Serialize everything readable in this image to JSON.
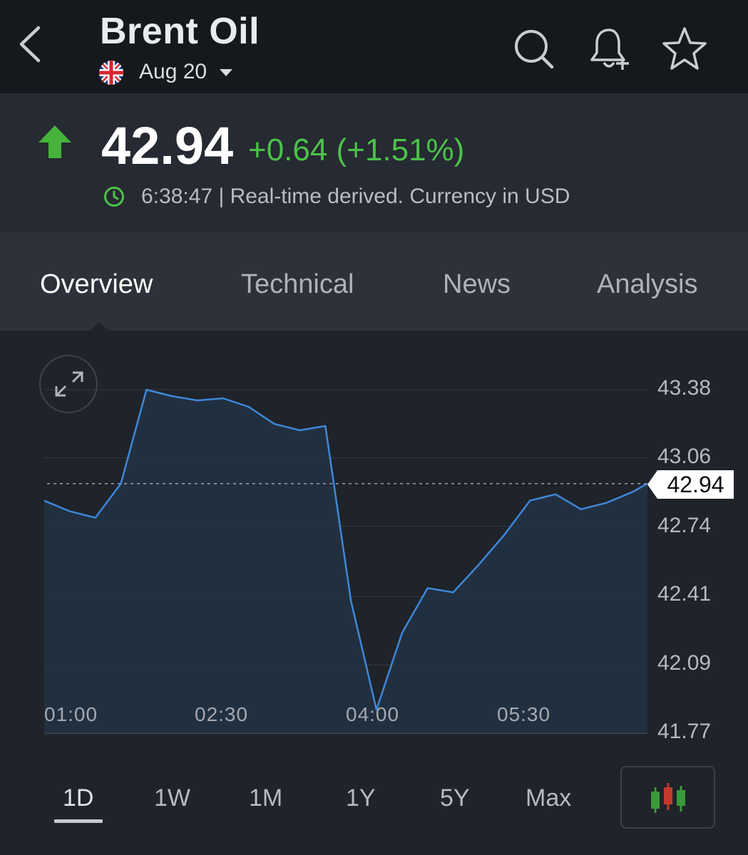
{
  "header": {
    "title": "Brent Oil",
    "date": "Aug 20"
  },
  "quote": {
    "price": "42.94",
    "change": "+0.64 (+1.51%)",
    "time": "6:38:47",
    "separator": "|",
    "status": "Real-time derived. Currency in USD",
    "direction": "up",
    "up_color": "#4cc24a"
  },
  "tabs": [
    "Overview",
    "Technical",
    "News",
    "Analysis"
  ],
  "active_tab": "Overview",
  "periods": [
    "1D",
    "1W",
    "1M",
    "1Y",
    "5Y",
    "Max"
  ],
  "active_period": "1D",
  "chart_data": {
    "type": "area",
    "ylim": [
      41.77,
      43.38
    ],
    "y_ticks": [
      "43.38",
      "43.06",
      "42.74",
      "42.41",
      "42.09",
      "41.77"
    ],
    "x_ticks": [
      "01:00",
      "02:30",
      "04:00",
      "05:30"
    ],
    "last_price": "42.94",
    "line_color": "#3f87d9",
    "x": [
      "00:44",
      "00:59",
      "01:14",
      "01:29",
      "01:44",
      "01:59",
      "02:14",
      "02:29",
      "02:44",
      "02:59",
      "03:14",
      "03:29",
      "03:44",
      "03:59",
      "04:14",
      "04:29",
      "04:44",
      "04:59",
      "05:14",
      "05:29",
      "05:44",
      "05:59",
      "06:14",
      "06:29",
      "06:38"
    ],
    "values": [
      42.86,
      42.81,
      42.78,
      42.94,
      43.38,
      43.35,
      43.33,
      43.34,
      43.3,
      43.22,
      43.19,
      43.21,
      42.39,
      41.88,
      42.24,
      42.45,
      42.43,
      42.56,
      42.7,
      42.86,
      42.89,
      42.82,
      42.85,
      42.9,
      42.94
    ]
  }
}
